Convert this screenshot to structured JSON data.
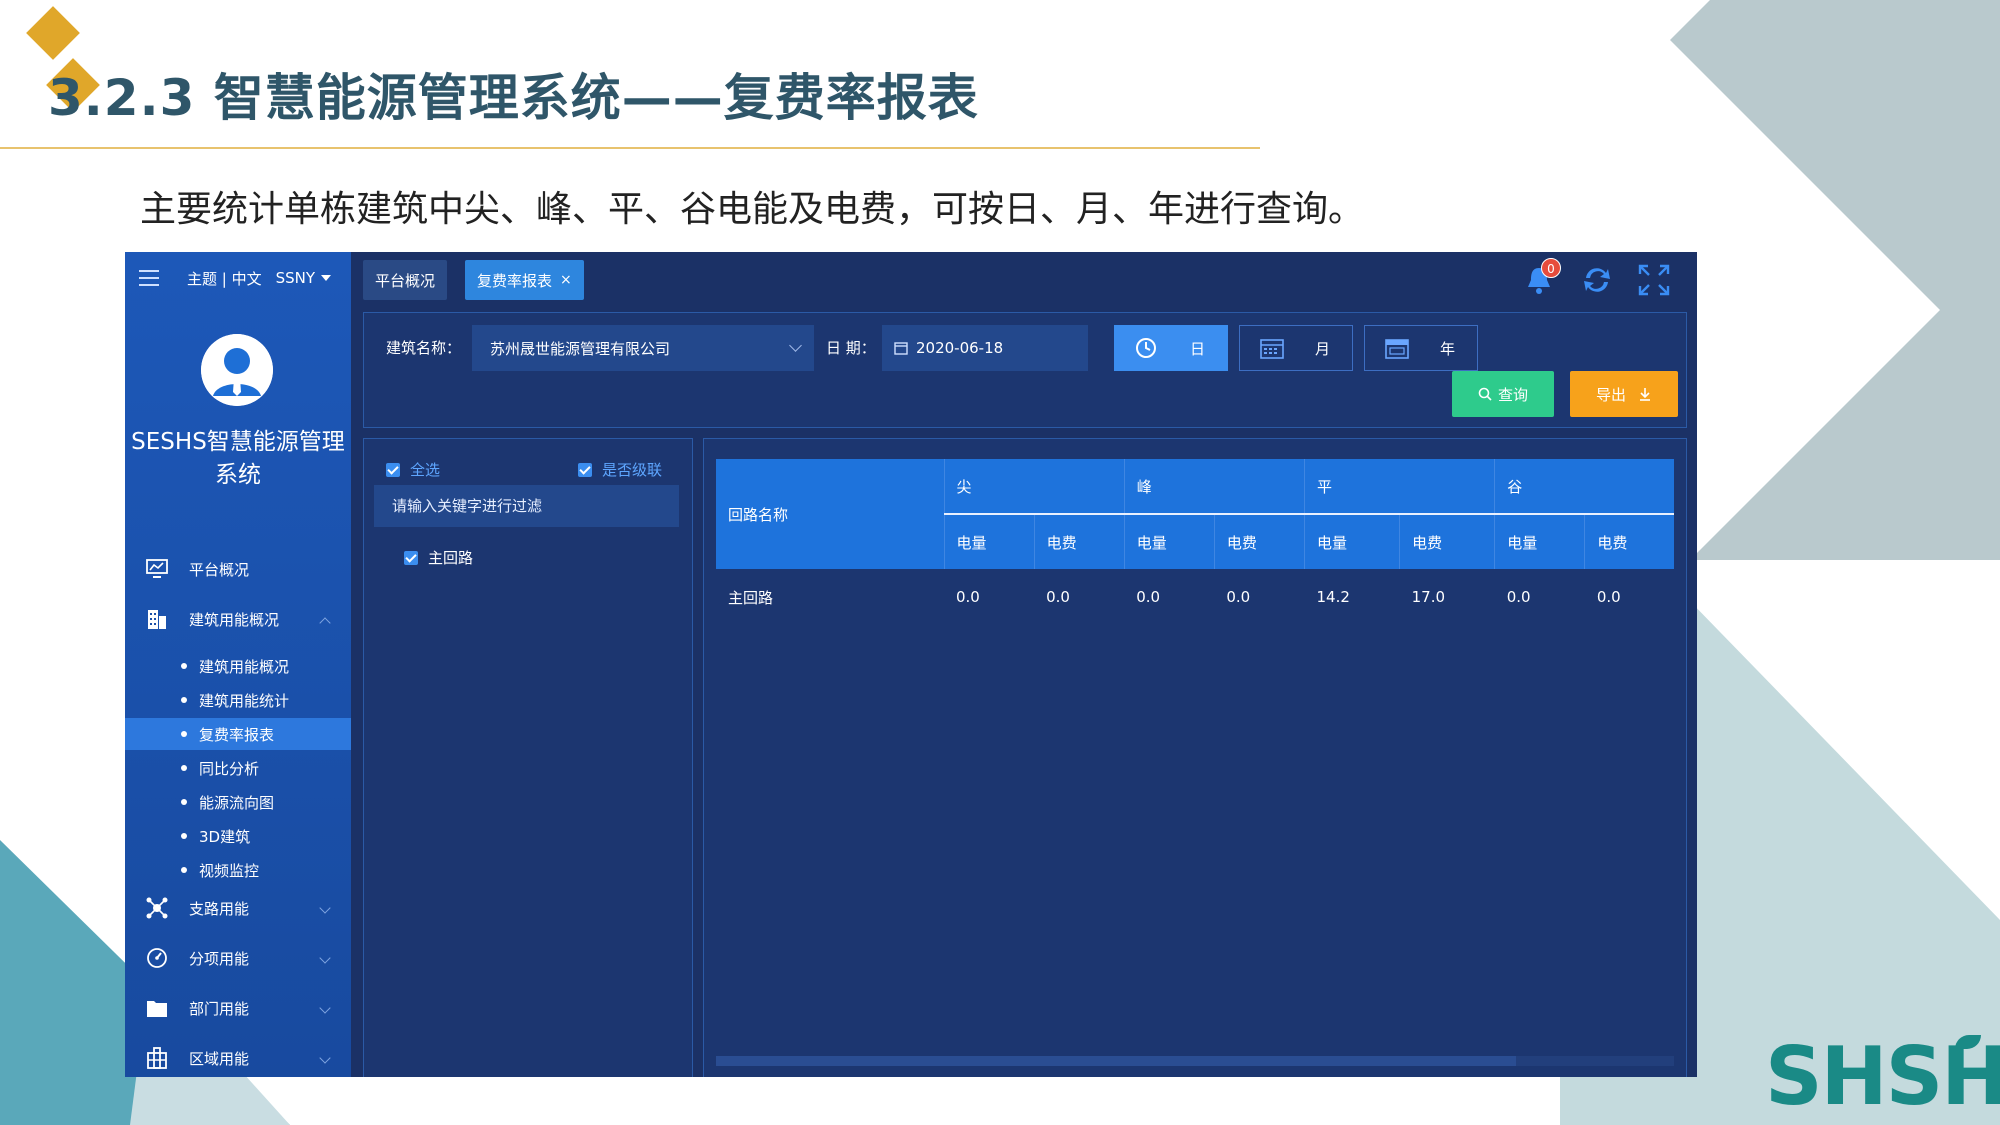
{
  "slide": {
    "title": "3.2.3 智慧能源管理系统——复费率报表",
    "subtitle": "主要统计单栋建筑中尖、峰、平、谷电能及电费，可按日、月、年进行查询。",
    "logo_text": "SHSHI",
    "colors": {
      "title": "#2f5669",
      "accent": "#e0a72a",
      "teal": "#1a8a86"
    }
  },
  "app": {
    "header": {
      "theme_lang": "主题 | 中文",
      "user": "SSNY"
    },
    "system_name": "SESHS智慧能源管理系统",
    "tabs": [
      {
        "label": "平台概况"
      },
      {
        "label": "复费率报表",
        "close": "×"
      }
    ],
    "notifications": {
      "count": "0"
    },
    "nav": [
      {
        "label": "平台概况",
        "icon": "monitor-chart-icon"
      },
      {
        "label": "建筑用能概况",
        "icon": "building-icon"
      },
      {
        "label": "支路用能",
        "icon": "network-icon"
      },
      {
        "label": "分项用能",
        "icon": "gauge-icon"
      },
      {
        "label": "部门用能",
        "icon": "folder-icon"
      },
      {
        "label": "区域用能",
        "icon": "region-icon"
      }
    ],
    "subnav": [
      {
        "label": "建筑用能概况"
      },
      {
        "label": "建筑用能统计"
      },
      {
        "label": "复费率报表",
        "active": true
      },
      {
        "label": "同比分析"
      },
      {
        "label": "能源流向图"
      },
      {
        "label": "3D建筑"
      },
      {
        "label": "视频监控"
      }
    ],
    "filter": {
      "building_label": "建筑名称：",
      "building_value": "苏州晟世能源管理有限公司",
      "date_label": "日 期：",
      "date_value": "2020-06-18",
      "period_day": "日",
      "period_month": "月",
      "period_year": "年",
      "query_button": "查询",
      "export_button": "导出"
    },
    "tree": {
      "select_all": "全选",
      "cascade": "是否级联",
      "search_placeholder": "请输入关键字进行过滤",
      "nodes": [
        {
          "label": "主回路",
          "checked": true
        }
      ]
    },
    "report": {
      "row_header": "回路名称",
      "groups": [
        "尖",
        "峰",
        "平",
        "谷"
      ],
      "sub_columns": [
        "电量",
        "电费",
        "电量",
        "电费",
        "电量",
        "电费",
        "电量",
        "电费"
      ],
      "rows": [
        {
          "name": "主回路",
          "values": [
            "0.0",
            "0.0",
            "0.0",
            "0.0",
            "14.2",
            "17.0",
            "0.0",
            "0.0"
          ]
        }
      ]
    },
    "colors": {
      "sidebar": "#1a4fa8",
      "background": "#1b3166",
      "active": "#2d78dd",
      "query": "#2ecb8c",
      "export": "#f7a21b",
      "table_header": "#1e73dc"
    }
  }
}
